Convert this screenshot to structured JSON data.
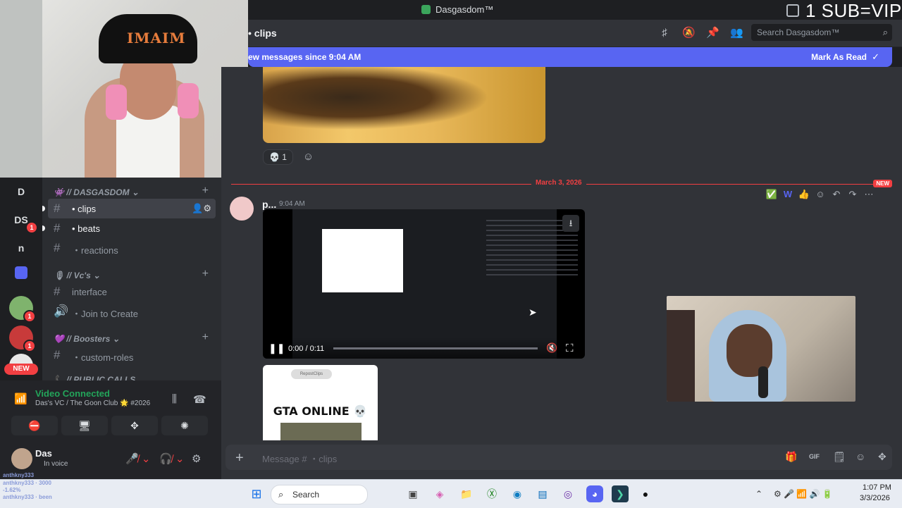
{
  "window": {
    "title": "Dasgasdom™",
    "overlay_text": "1 SUB=VIP"
  },
  "channel": {
    "name": "clips",
    "search_placeholder": "Search Dasgasdom™"
  },
  "banner": {
    "text": "ew messages since 9:04 AM",
    "action": "Mark As Read"
  },
  "messages": {
    "reaction_count": "1",
    "divider_date": "March 3, 2026",
    "new_tag": "NEW",
    "author": "p...",
    "time": "9:04 AM",
    "video": {
      "timecode": "0:00 / 0:11",
      "progress": 0.0
    },
    "card_title": "GTA ONLINE 💀",
    "card_pill": "RepostClips"
  },
  "servers": {
    "items": [
      {
        "label": "D"
      },
      {
        "label": "DS",
        "badge": "1"
      },
      {
        "label": "n"
      },
      {
        "label": "",
        "badge": ""
      },
      {
        "label": "",
        "badge": "1"
      },
      {
        "label": "",
        "badge": "1"
      }
    ],
    "new_label": "NEW"
  },
  "sidebar": {
    "server_category": "// DASGASDOM",
    "channels_main": [
      {
        "label": "clips",
        "active": true
      },
      {
        "label": "beats",
        "unread": true
      },
      {
        "label": "reactions"
      }
    ],
    "category_vcs": "// Vc's",
    "channels_vcs": [
      {
        "label": "interface"
      },
      {
        "label": "Join to Create"
      }
    ],
    "category_boosters": "// Boosters",
    "channels_boosters": [
      {
        "label": "custom-roles"
      }
    ],
    "category_public": "// PUBLIC CALLS"
  },
  "voice": {
    "status": "Video Connected",
    "location": "Das's VC / The Goon Club 🌟 #2026"
  },
  "user": {
    "name": "Das",
    "status": "In voice"
  },
  "composer": {
    "placeholder": "Message # ・clips"
  },
  "taskbar": {
    "search_label": "Search",
    "time": "1:07 PM",
    "date": "3/3/2026"
  },
  "stream_overlay": {
    "lines": [
      "anthkny333",
      "anthkny333 · 3000",
      "-1.62%",
      "anthkny333 · been"
    ]
  },
  "colors": {
    "blurple": "#5865f2",
    "red": "#f23f42",
    "green": "#23a55a",
    "bg": "#313338"
  }
}
